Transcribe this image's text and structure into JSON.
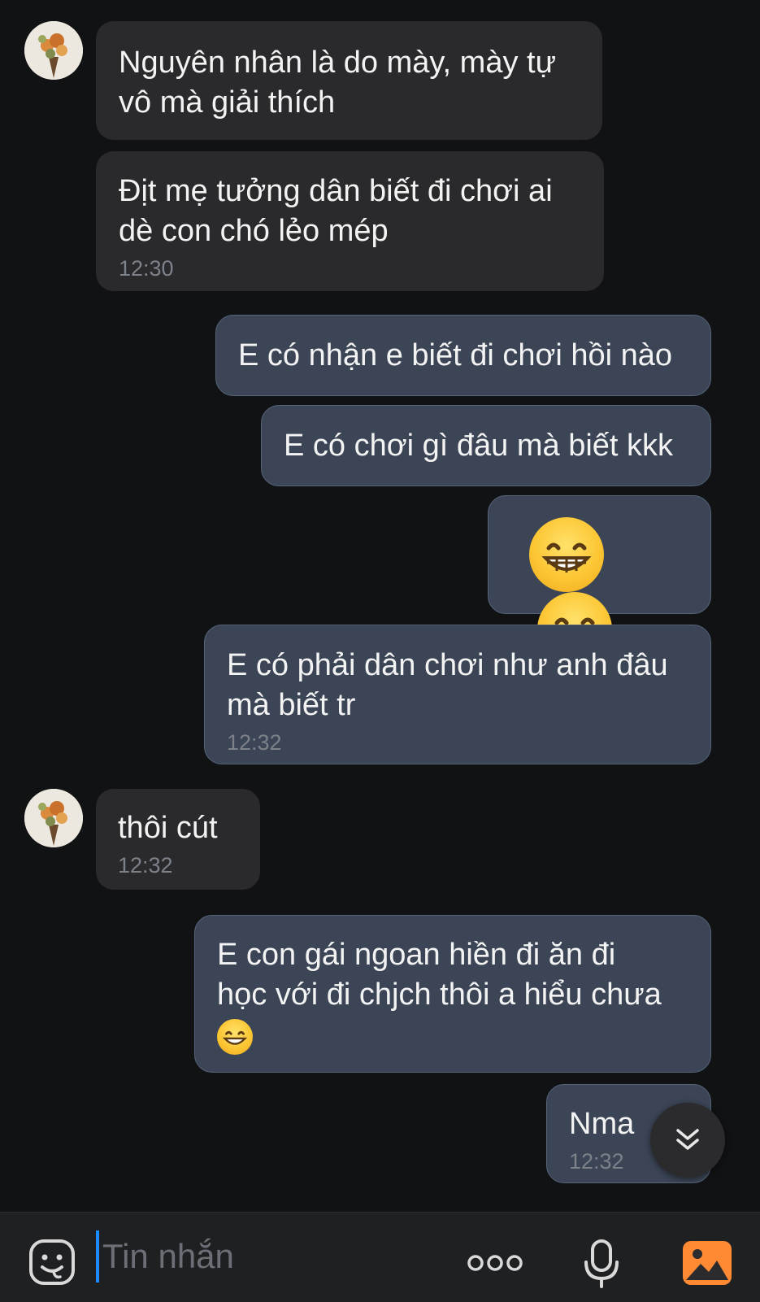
{
  "messages": [
    {
      "text": "Nguyên nhân là do mày, mày tự\nvô mà giải thích",
      "time": ""
    },
    {
      "text": "Địt mẹ tưởng dân biết đi chơi ai\ndè con chó lẻo mép",
      "time": "12:30"
    },
    {
      "text": "E có nhận e biết đi chơi hồi nào",
      "time": ""
    },
    {
      "text": "E có chơi gì đâu mà biết kkk",
      "time": ""
    },
    {
      "emoji": "grinning-face-emoji x2"
    },
    {
      "text": "E có phải dân chơi như anh đâu\nmà biết tr",
      "time": "12:32"
    },
    {
      "text": "thôi cút",
      "time": "12:32"
    },
    {
      "text": "E con gái ngoan hiền đi ăn đi\nhọc với đi chjch thôi a hiểu chưa",
      "time": ""
    },
    {
      "text": "Nma",
      "time": "12:32"
    }
  ],
  "composer": {
    "placeholder": "Tin nhắn"
  },
  "icons": {
    "sticker": "sticker-icon",
    "more": "more-options-icon",
    "mic": "microphone-icon",
    "gallery": "gallery-icon",
    "scroll": "scroll-to-bottom-icon"
  },
  "colors": {
    "background": "#111214",
    "incoming_bubble": "#2a2a2d",
    "outgoing_bubble": "#3b4555",
    "accent": "#1e88ff",
    "gallery": "#ff8a33"
  }
}
